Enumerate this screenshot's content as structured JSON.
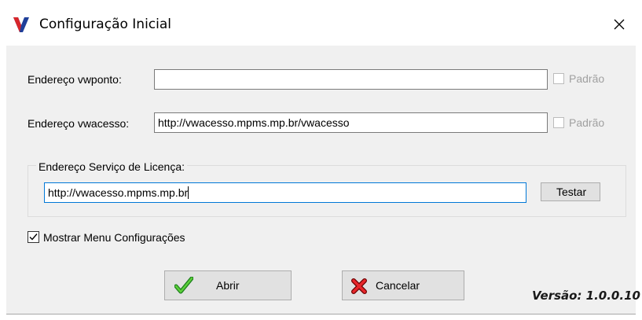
{
  "window": {
    "title": "Configuração Inicial",
    "brand_color": "#1f3f99",
    "accent_color": "#d7262b"
  },
  "form": {
    "vwponto": {
      "label": "Endereço vwponto:",
      "value": "",
      "default_checkbox": {
        "label": "Padrão",
        "checked": false,
        "enabled": false
      }
    },
    "vwacesso": {
      "label": "Endereço vwacesso:",
      "value": "http://vwacesso.mpms.mp.br/vwacesso",
      "default_checkbox": {
        "label": "Padrão",
        "checked": false,
        "enabled": false
      }
    },
    "license": {
      "group_label": "Endereço Serviço de Licença:",
      "value": "http://vwacesso.mpms.mp.br",
      "test_button": "Testar"
    },
    "show_menu": {
      "label": "Mostrar Menu Configurações",
      "checked": true
    }
  },
  "buttons": {
    "open": {
      "label": "Abrir",
      "icon": "green-check-icon"
    },
    "cancel": {
      "label": "Cancelar",
      "icon": "red-x-icon"
    }
  },
  "version": "Versão: 1.0.0.10"
}
